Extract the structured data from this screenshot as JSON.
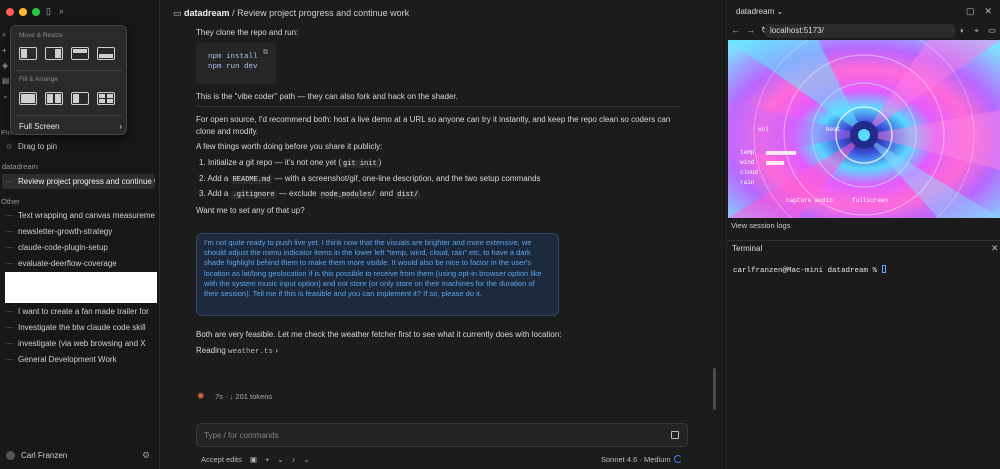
{
  "sidebar": {
    "pinned_label": "Pin",
    "drag_to_pin": "Drag to pin",
    "project": "datadream",
    "active_item": "Review project progress and continue work",
    "other_label": "Other",
    "other_items": [
      "Text wrapping and canvas measurement",
      "newsletter-growth-strategy",
      "claude-code-plugin-setup",
      "evaluate-deerflow-coverage"
    ],
    "more_items": [
      "I want to create a fan made trailer for",
      "Investigate the btw claude code skill",
      "investigate (via web browsing and X",
      "General Development Work"
    ],
    "user": "Carl Franzen"
  },
  "popup": {
    "move_resize": "Move & Resize",
    "fill_arrange": "Fill & Arrange",
    "full_screen": "Full Screen"
  },
  "main": {
    "breadcrumb_project": "datadream",
    "breadcrumb_sep": " / ",
    "breadcrumb_title": "Review project progress and continue work",
    "line_clone": "They clone the repo and run:",
    "code": [
      "npm install",
      "npm run dev"
    ],
    "vibe": "This is the \"vibe coder\" path — they can also fork and hack on the shader.",
    "recommend_1": "For open source, I'd recommend both: host a live demo at a URL so anyone can try it instantly, and keep the repo clean so coders can",
    "recommend_2": "clone and modify.",
    "worth": "A few things worth doing before you share it publicly:",
    "step1_a": "1. Initialize a git repo — it's not one yet (",
    "step1_code": "git init",
    "step1_b": ")",
    "step2_a": "2. Add a ",
    "step2_code": "README.md",
    "step2_b": " — with a screenshot/gif, one-line description, and the two setup commands",
    "step3_a": "3. Add a ",
    "step3_code": ".gitignore",
    "step3_b": " — exclude ",
    "step3_code2": "node_modules/",
    "step3_c": " and ",
    "step3_code3": "dist/",
    "want": "Want me to set any of that up?",
    "user_message": "I'm not quite ready to push live yet. I think now that the visuals are brighter and more extensive, we should adjust the menu indicator items in the lower left \"temp, wind, cloud, rain\" etc, to have a dark shade highlight behind them to make them more visible. It would also be nice to factor in the user's location as lat/long geolocation if is this possible to receive from them (using opt-in browser option like with the system music input option) and not store (or only store on their machines for the duration of their session). Tell me if this is feasible and you can implement it? If so, please do it.",
    "feasible": "Both are very feasible. Let me check the weather fetcher first to see what it currently does with location:",
    "reading_label": "Reading",
    "reading_file": "weather.ts",
    "tokens": "7s · ↓ 201 tokens",
    "input_placeholder": "Type / for commands",
    "accept_edits": "Accept edits",
    "model": "Sonnet 4.6 · Medium"
  },
  "right": {
    "title": "datadream",
    "url": "localhost:5173/",
    "viz_labels": [
      "temp",
      "wind",
      "cloud",
      "rain"
    ],
    "viz_top": [
      "vol",
      "beat"
    ],
    "viz_bottom": [
      "capture audio",
      "fullscreen"
    ],
    "view_logs": "View session logs",
    "terminal_title": "Terminal",
    "prompt": "carlfranzen@Mac-mini datadream % "
  },
  "colors": {
    "accent": "#3b82f6",
    "user_bubble_text": "#5fa3ec",
    "spark": "#e06b4a"
  }
}
